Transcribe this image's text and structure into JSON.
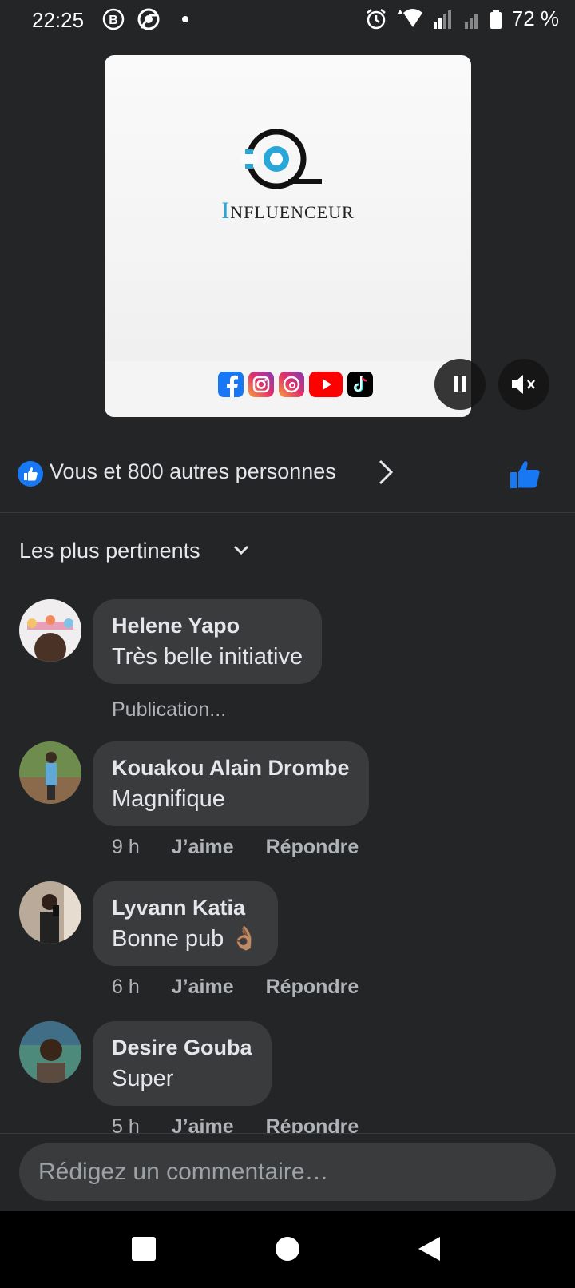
{
  "status_bar": {
    "time": "22:25",
    "battery": "72 %"
  },
  "video": {
    "brand_first": "I",
    "brand_rest": "NFLUENCEUR"
  },
  "reactions": {
    "text": "Vous et 800 autres personnes"
  },
  "sort": {
    "label": "Les plus pertinents"
  },
  "comments": [
    {
      "name": "Helene Yapo",
      "text": "Très belle initiative",
      "status": "Publication..."
    },
    {
      "name": "Kouakou Alain Drombe",
      "text": "Magnifique",
      "time": "9 h",
      "like": "J’aime",
      "reply": "Répondre"
    },
    {
      "name": "Lyvann Katia",
      "text": "Bonne pub 👌🏽",
      "time": "6 h",
      "like": "J’aime",
      "reply": "Répondre"
    },
    {
      "name": "Desire Gouba",
      "text": "Super",
      "time": "5 h",
      "like": "J’aime",
      "reply": "Répondre"
    }
  ],
  "composer": {
    "placeholder": "Rédigez un commentaire…"
  },
  "colors": {
    "background": "#242526",
    "bubble": "#3a3b3c",
    "accent": "#1877f2"
  }
}
